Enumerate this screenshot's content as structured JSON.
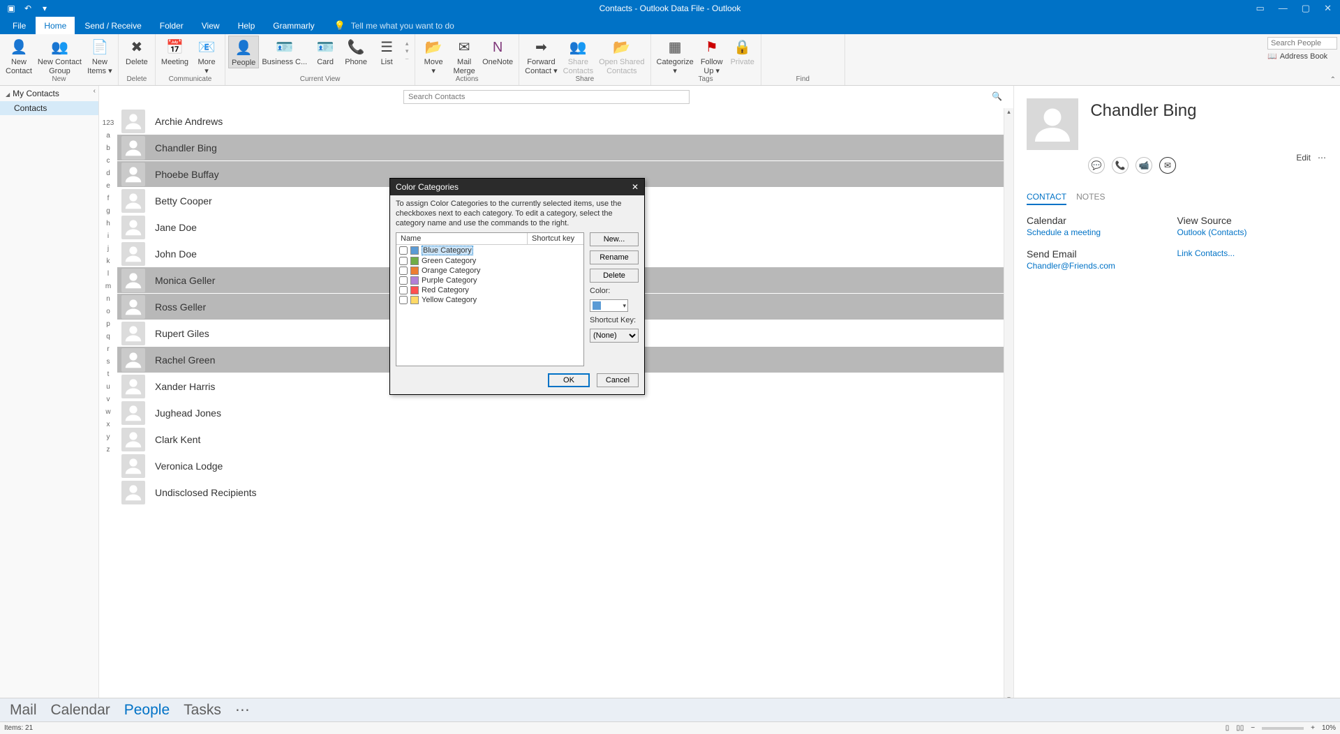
{
  "titlebar": {
    "title": "Contacts - Outlook Data File  -  Outlook"
  },
  "wincontrols": {
    "min": "—",
    "max": "▢",
    "close": "✕",
    "mode": "▭"
  },
  "tabs": {
    "file": "File",
    "items": [
      "Home",
      "Send / Receive",
      "Folder",
      "View",
      "Help",
      "Grammarly"
    ],
    "tell": "Tell me what you want to do"
  },
  "ribbon": {
    "groups": {
      "new": {
        "label": "New",
        "buttons": [
          {
            "label": "New\nContact"
          },
          {
            "label": "New Contact\nGroup"
          },
          {
            "label": "New\nItems ▾"
          }
        ]
      },
      "delete": {
        "label": "Delete",
        "buttons": [
          {
            "label": "Delete"
          }
        ]
      },
      "communicate": {
        "label": "Communicate",
        "buttons": [
          {
            "label": "Meeting"
          },
          {
            "label": "More\n▾"
          }
        ]
      },
      "currentview": {
        "label": "Current View",
        "buttons": [
          {
            "label": "People",
            "selected": true
          },
          {
            "label": "Business C..."
          },
          {
            "label": "Card"
          },
          {
            "label": "Phone"
          },
          {
            "label": "List"
          }
        ]
      },
      "actions": {
        "label": "Actions",
        "buttons": [
          {
            "label": "Move\n▾"
          },
          {
            "label": "Mail\nMerge"
          },
          {
            "label": "OneNote"
          }
        ]
      },
      "share": {
        "label": "Share",
        "buttons": [
          {
            "label": "Forward\nContact ▾"
          },
          {
            "label": "Share\nContacts",
            "disabled": true
          },
          {
            "label": "Open Shared\nContacts",
            "disabled": true
          }
        ]
      },
      "tags": {
        "label": "Tags",
        "buttons": [
          {
            "label": "Categorize\n▾"
          },
          {
            "label": "Follow\nUp ▾"
          },
          {
            "label": "Private",
            "disabled": true
          }
        ]
      },
      "find": {
        "label": "Find",
        "search_placeholder": "Search People",
        "ab": "Address Book"
      }
    }
  },
  "leftnav": {
    "heading": "My Contacts",
    "items": [
      "Contacts"
    ]
  },
  "alpha": [
    "123",
    "a",
    "b",
    "c",
    "d",
    "e",
    "f",
    "g",
    "h",
    "i",
    "j",
    "k",
    "l",
    "m",
    "n",
    "o",
    "p",
    "q",
    "r",
    "s",
    "t",
    "u",
    "v",
    "w",
    "x",
    "y",
    "z"
  ],
  "search": {
    "placeholder": "Search Contacts"
  },
  "contacts": [
    {
      "name": "Archie Andrews",
      "selected": false
    },
    {
      "name": "Chandler Bing",
      "selected": true
    },
    {
      "name": "Phoebe Buffay",
      "selected": true
    },
    {
      "name": "Betty Cooper",
      "selected": false
    },
    {
      "name": "Jane Doe",
      "selected": false
    },
    {
      "name": "John Doe",
      "selected": false
    },
    {
      "name": "Monica Geller",
      "selected": true
    },
    {
      "name": "Ross Geller",
      "selected": true
    },
    {
      "name": "Rupert Giles",
      "selected": false
    },
    {
      "name": "Rachel Green",
      "selected": true
    },
    {
      "name": "Xander Harris",
      "selected": false
    },
    {
      "name": "Jughead Jones",
      "selected": false
    },
    {
      "name": "Clark Kent",
      "selected": false
    },
    {
      "name": "Veronica Lodge",
      "selected": false
    },
    {
      "name": "Undisclosed Recipients",
      "selected": false
    }
  ],
  "readingpane": {
    "name": "Chandler Bing",
    "edit": "Edit",
    "tabs": [
      "CONTACT",
      "NOTES"
    ],
    "calendar": {
      "hdr": "Calendar",
      "link": "Schedule a meeting"
    },
    "email": {
      "hdr": "Send Email",
      "link": "Chandler@Friends.com"
    },
    "viewsource": {
      "hdr": "View Source",
      "link": "Outlook (Contacts)"
    },
    "linkcontacts": "Link Contacts..."
  },
  "bottomnav": [
    "Mail",
    "Calendar",
    "People",
    "Tasks"
  ],
  "statusbar": {
    "items": "Items: 21",
    "zoom": "10%"
  },
  "dialog": {
    "title": "Color Categories",
    "desc": "To assign Color Categories to the currently selected items, use the checkboxes next to each category.  To edit a category, select the category name and use the commands to the right.",
    "col_name": "Name",
    "col_shortcut": "Shortcut key",
    "categories": [
      {
        "name": "Blue Category",
        "color": "#5b9bd5",
        "highlighted": true
      },
      {
        "name": "Green Category",
        "color": "#70ad47"
      },
      {
        "name": "Orange Category",
        "color": "#ed7d31"
      },
      {
        "name": "Purple Category",
        "color": "#b180d7"
      },
      {
        "name": "Red Category",
        "color": "#ff5050"
      },
      {
        "name": "Yellow Category",
        "color": "#ffd966"
      }
    ],
    "btn_new": "New...",
    "btn_rename": "Rename",
    "btn_delete": "Delete",
    "lbl_color": "Color:",
    "sel_color": "#5b9bd5",
    "lbl_shortcut": "Shortcut Key:",
    "sel_shortcut": "(None)",
    "btn_ok": "OK",
    "btn_cancel": "Cancel"
  }
}
